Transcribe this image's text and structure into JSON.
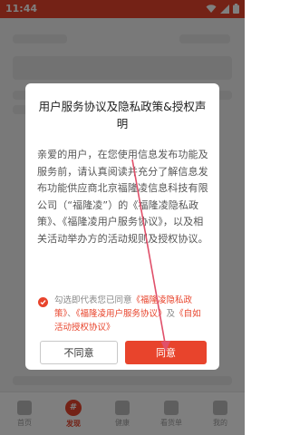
{
  "status_bar": {
    "time": "11:44"
  },
  "bottom_nav": {
    "items": [
      {
        "label": "首页"
      },
      {
        "label": "发现",
        "icon_text": "#"
      },
      {
        "label": "健康"
      },
      {
        "label": "看货单"
      },
      {
        "label": "我的"
      }
    ]
  },
  "dialog": {
    "title": "用户服务协议及隐私政策&授权声明",
    "body": "亲爱的用户，在您使用信息发布功能及服务前，请认真阅读并充分了解信息发布功能供应商北京福隆凌信息科技有限公司（“福隆凌”）的《福隆凌隐私政策》、《福隆凌用户服务协议》，以及相关活动举办方的活动规则及授权协议。",
    "consent": {
      "prefix": "勾选即代表您已同意",
      "link_privacy": "《福隆凌隐私政策》",
      "sep1": "、",
      "link_terms": "《福隆凌用户服务协议》",
      "sep2": "及",
      "link_activity": "《自如活动授权协议》",
      "checked": true
    },
    "decline_label": "不同意",
    "agree_label": "同意"
  },
  "colors": {
    "accent": "#e8442c",
    "arrow": "#e0506a"
  }
}
